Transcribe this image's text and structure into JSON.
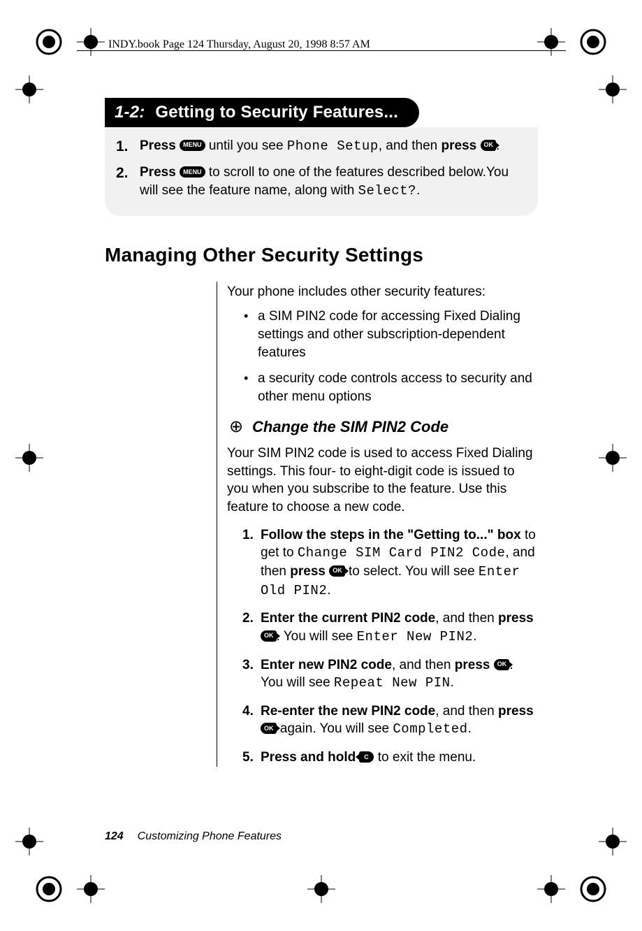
{
  "header_note": "INDY.book  Page 124  Thursday, August 20, 1998  8:57 AM",
  "section": {
    "number": "1-2:",
    "title": "Getting to Security Features..."
  },
  "steps": [
    {
      "num": "1.",
      "pre_bold": "Press",
      "key1": "MENU",
      "mid": " until you see ",
      "lcd": "Phone Setup",
      "mid2": ", and then ",
      "bold2": "press",
      "key2": "OK",
      "tail": "."
    },
    {
      "num": "2.",
      "pre_bold": "Press",
      "key1": "MENU",
      "mid": " to scroll to one of the features described below.You will see the feature name, along with ",
      "lcd": "Select?",
      "tail": "."
    }
  ],
  "h2": "Managing Other Security Settings",
  "intro_p": "Your phone includes other security features:",
  "bullets": [
    "a SIM PIN2 code for accessing Fixed Dialing settings and other subscription-dependent features",
    "a security code controls access to security and other menu options"
  ],
  "h3": "Change the SIM PIN2 Code",
  "p2": "Your SIM PIN2 code is used to access Fixed Dialing settings. This four- to eight-digit code is issued to you when you subscribe to the feature. Use this feature to choose a new code.",
  "numlist": [
    {
      "n": "1.",
      "bold": "Follow the steps in the \"Getting to...\" box",
      "t1": " to get to ",
      "lcd1": "Change SIM Card PIN2 Code",
      "t2": ", and then ",
      "bold2": "press",
      "key": "OK",
      "t3": " to select. You will see ",
      "lcd2": "Enter Old PIN2",
      "t4": "."
    },
    {
      "n": "2.",
      "bold": "Enter the current PIN2 code",
      "t1": ", and then ",
      "bold2": "press",
      "key": "OK",
      "t2": ". You will see ",
      "lcd1": "Enter New PIN2",
      "t3": "."
    },
    {
      "n": "3.",
      "bold": "Enter new PIN2 code",
      "t1": ", and then ",
      "bold2": "press",
      "key": "OK",
      "t2": ". You will see ",
      "lcd1": "Repeat New PIN",
      "t3": "."
    },
    {
      "n": "4.",
      "bold": "Re-enter the new PIN2 code",
      "t1": ", and then ",
      "bold2": "press",
      "key": "OK",
      "t2": " again. You will see ",
      "lcd1": "Completed",
      "t3": "."
    },
    {
      "n": "5.",
      "bold": "Press and hold",
      "key_c": "C",
      "t1": " to exit the menu."
    }
  ],
  "footer": {
    "page": "124",
    "title": "Customizing Phone Features"
  }
}
